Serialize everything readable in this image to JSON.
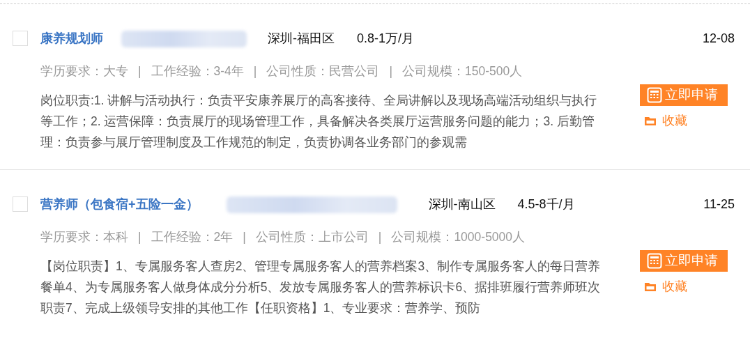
{
  "jobs": [
    {
      "checked": false,
      "title": "康养规划师",
      "location": "深圳-福田区",
      "salary": "0.8-1万/月",
      "date": "12-08",
      "meta": [
        "学历要求：大专",
        "工作经验：3-4年",
        "公司性质：民营公司",
        "公司规模：150-500人"
      ],
      "separator": "|",
      "description": "岗位职责:1. 讲解与活动执行：负责平安康养展厅的高客接待、全局讲解以及现场高端活动组织与执行等工作；2. 运营保障：负责展厅的现场管理工作，具备解决各类展厅运营服务问题的能力；3. 后勤管理：负责参与展厅管理制度及工作规范的制定，负责协调各业务部门的参观需",
      "apply": "立即申请",
      "favorite": "收藏"
    },
    {
      "checked": false,
      "title": "营养师（包食宿+五险一金）",
      "location": "深圳-南山区",
      "salary": "4.5-8千/月",
      "date": "11-25",
      "meta": [
        "学历要求：本科",
        "工作经验：2年",
        "公司性质：上市公司",
        "公司规模：1000-5000人"
      ],
      "separator": "|",
      "description": "【岗位职责】1、专属服务客人查房2、管理专属服务客人的营养档案3、制作专属服务客人的每日营养餐单4、为专属服务客人做身体成分分析5、发放专属服务客人的营养标识卡6、据排班履行营养师班次职责7、完成上级领导安排的其他工作【任职资格】1、专业要求：营养学、预防",
      "apply": "立即申请",
      "favorite": "收藏"
    }
  ]
}
